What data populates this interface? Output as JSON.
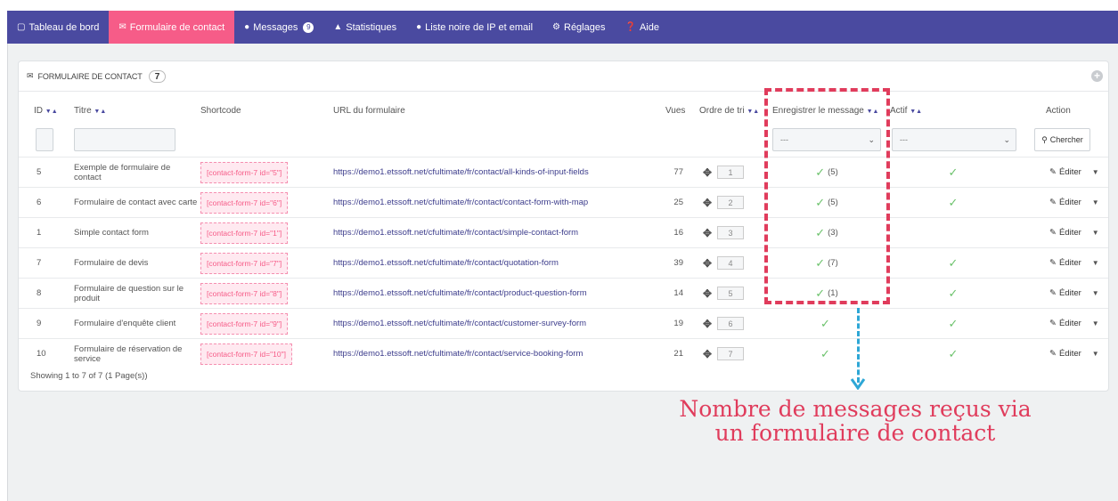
{
  "nav": {
    "items": [
      {
        "label": "Tableau de bord",
        "icon": "monitor-icon"
      },
      {
        "label": "Formulaire de contact",
        "icon": "envelope-icon"
      },
      {
        "label": "Messages",
        "icon": "comments-icon",
        "badge": "9"
      },
      {
        "label": "Statistiques",
        "icon": "area-chart-icon"
      },
      {
        "label": "Liste noire de IP et email",
        "icon": "user-block-icon"
      },
      {
        "label": "Réglages",
        "icon": "gear-icon"
      },
      {
        "label": "Aide",
        "icon": "question-icon"
      }
    ]
  },
  "panel": {
    "title": "FORMULAIRE DE CONTACT",
    "count": "7"
  },
  "columns": {
    "id": "ID",
    "title": "Titre",
    "shortcode": "Shortcode",
    "url": "URL du formulaire",
    "views": "Vues",
    "order": "Ordre de tri",
    "save": "Enregistrer le message",
    "active": "Actif",
    "action": "Action"
  },
  "filters": {
    "save_select": "---",
    "active_select": "---",
    "search_label": "Chercher"
  },
  "rows": [
    {
      "id": "5",
      "title": "Exemple de formulaire de contact",
      "shortcode": "[contact-form-7 id=\"5\"]",
      "url": "https://demo1.etssoft.net/cfultimate/fr/contact/all-kinds-of-input-fields",
      "views": "77",
      "order": "1",
      "save_count": "(5)",
      "active": true,
      "action": "Éditer"
    },
    {
      "id": "6",
      "title": "Formulaire de contact avec carte",
      "shortcode": "[contact-form-7 id=\"6\"]",
      "url": "https://demo1.etssoft.net/cfultimate/fr/contact/contact-form-with-map",
      "views": "25",
      "order": "2",
      "save_count": "(5)",
      "active": true,
      "action": "Éditer"
    },
    {
      "id": "1",
      "title": "Simple contact form",
      "shortcode": "[contact-form-7 id=\"1\"]",
      "url": "https://demo1.etssoft.net/cfultimate/fr/contact/simple-contact-form",
      "views": "16",
      "order": "3",
      "save_count": "(3)",
      "active": false,
      "action": "Éditer"
    },
    {
      "id": "7",
      "title": "Formulaire de devis",
      "shortcode": "[contact-form-7 id=\"7\"]",
      "url": "https://demo1.etssoft.net/cfultimate/fr/contact/quotation-form",
      "views": "39",
      "order": "4",
      "save_count": "(7)",
      "active": true,
      "action": "Éditer"
    },
    {
      "id": "8",
      "title": "Formulaire de question sur le produit",
      "shortcode": "[contact-form-7 id=\"8\"]",
      "url": "https://demo1.etssoft.net/cfultimate/fr/contact/product-question-form",
      "views": "14",
      "order": "5",
      "save_count": "(1)",
      "active": true,
      "action": "Éditer"
    },
    {
      "id": "9",
      "title": "Formulaire d'enquête client",
      "shortcode": "[contact-form-7 id=\"9\"]",
      "url": "https://demo1.etssoft.net/cfultimate/fr/contact/customer-survey-form",
      "views": "19",
      "order": "6",
      "save_count": "",
      "active": true,
      "action": "Éditer"
    },
    {
      "id": "10",
      "title": "Formulaire de réservation de service",
      "shortcode": "[contact-form-7 id=\"10\"]",
      "url": "https://demo1.etssoft.net/cfultimate/fr/contact/service-booking-form",
      "views": "21",
      "order": "7",
      "save_count": "",
      "active": true,
      "action": "Éditer"
    }
  ],
  "footer": "Showing 1 to 7 of 7 (1 Page(s))",
  "annotation": {
    "line1": "Nombre de messages reçus via",
    "line2": "un formulaire de contact"
  },
  "colors": {
    "nav_bg": "#4a4aa0",
    "nav_active": "#f65c88",
    "highlight": "#e03c5c",
    "arrow": "#2ea7d6",
    "check": "#6cc26c"
  }
}
